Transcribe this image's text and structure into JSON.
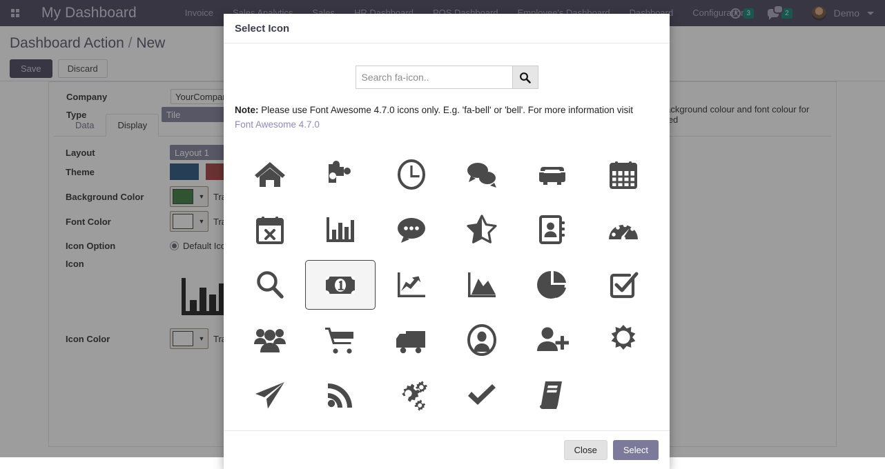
{
  "topbar": {
    "apps_icon": "apps-grid-icon",
    "brand": "My Dashboard",
    "menu": [
      {
        "label": "Invoice"
      },
      {
        "label": "Sales Analytics"
      },
      {
        "label": "Sales"
      },
      {
        "label": "HR Dashboard"
      },
      {
        "label": "POS Dashboard"
      },
      {
        "label": "Employee's Dashboard"
      },
      {
        "label": "Dashboard"
      },
      {
        "label": "Configuration"
      }
    ],
    "activities_icon": "clock-icon",
    "activities_count": "3",
    "messages_icon": "messages-icon",
    "messages_count": "2",
    "avatar_icon": "avatar",
    "user": "Demo",
    "caret_icon": "chevron-down-icon",
    "brand_color": "#3d3b52"
  },
  "breadcrumb": {
    "root": "Dashboard Action",
    "separator": "/",
    "current": "New",
    "save_label": "Save",
    "discard_label": "Discard"
  },
  "form": {
    "company_label": "Company",
    "company_value": "YourCompany",
    "type_label": "Type",
    "type_value": "Tile",
    "right_note": "Set background colour and font colour for selected"
  },
  "notebook": {
    "tabs": [
      {
        "label": "Data",
        "active": false
      },
      {
        "label": "Display",
        "active": true
      }
    ]
  },
  "display": {
    "layout_label": "Layout",
    "layout_value": "Layout 1",
    "theme_label": "Theme",
    "theme_swatch_1": "#1b4a77",
    "theme_swatch_2": "#9e3333",
    "background_color_label": "Background Color",
    "background_color_value": "#2f7132",
    "background_color_text": "Transparent",
    "font_color_label": "Font Color",
    "font_color_value": "#ffffff",
    "font_color_text": "Transparent",
    "icon_option_label": "Icon Option",
    "icon_option_value": "Default Icon",
    "icon_label": "Icon",
    "icon_preview": "bar-chart-icon",
    "icon_color_label": "Icon Color",
    "icon_color_value": "#ffffff",
    "icon_color_text": "Transparent",
    "dropdown_arrow": "▼"
  },
  "modal": {
    "title": "Select Icon",
    "search_placeholder": "Search fa-icon..",
    "search_value": "",
    "search_button_icon": "search-icon",
    "note_bold": "Note:",
    "note_text": " Please use Font Awesome 4.7.0 icons only. E.g. 'fa-bell' or 'bell'. For more information visit",
    "note_link": "Font Awesome 4.7.0",
    "close_label": "Close",
    "select_label": "Select",
    "selected_icon": "money-icon",
    "icons": [
      {
        "name": "home-icon",
        "selected": false
      },
      {
        "name": "puzzle-piece-icon",
        "selected": false
      },
      {
        "name": "clock-o-icon",
        "selected": false
      },
      {
        "name": "comments-icon",
        "selected": false
      },
      {
        "name": "car-icon",
        "selected": false
      },
      {
        "name": "calendar-icon",
        "selected": false
      },
      {
        "name": "calendar-times-o-icon",
        "selected": false
      },
      {
        "name": "bar-chart-icon",
        "selected": false
      },
      {
        "name": "commenting-icon",
        "selected": false
      },
      {
        "name": "star-half-o-icon",
        "selected": false
      },
      {
        "name": "address-book-icon",
        "selected": false
      },
      {
        "name": "tachometer-icon",
        "selected": false
      },
      {
        "name": "search-icon",
        "selected": false
      },
      {
        "name": "money-icon",
        "selected": true
      },
      {
        "name": "line-chart-icon",
        "selected": false
      },
      {
        "name": "area-chart-icon",
        "selected": false
      },
      {
        "name": "pie-chart-icon",
        "selected": false
      },
      {
        "name": "check-square-o-icon",
        "selected": false
      },
      {
        "name": "users-icon",
        "selected": false
      },
      {
        "name": "shopping-cart-icon",
        "selected": false
      },
      {
        "name": "truck-icon",
        "selected": false
      },
      {
        "name": "user-circle-icon",
        "selected": false
      },
      {
        "name": "user-plus-icon",
        "selected": false
      },
      {
        "name": "sun-o-icon",
        "selected": false
      },
      {
        "name": "paper-plane-icon",
        "selected": false
      },
      {
        "name": "rss-icon",
        "selected": false
      },
      {
        "name": "cogs-icon",
        "selected": false
      },
      {
        "name": "check-icon",
        "selected": false
      },
      {
        "name": "book-icon",
        "selected": false
      }
    ]
  }
}
